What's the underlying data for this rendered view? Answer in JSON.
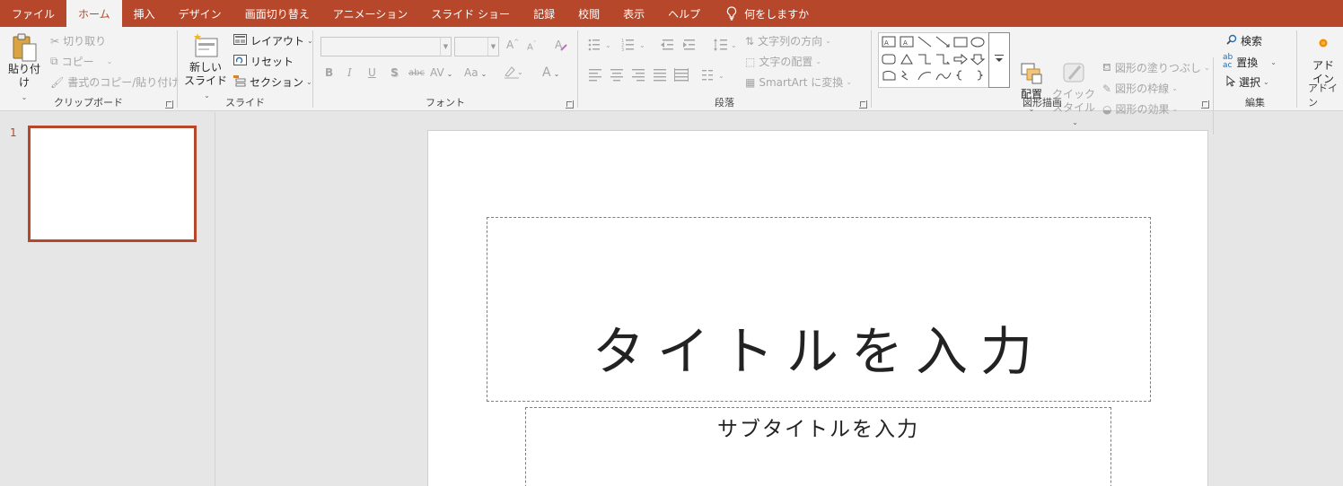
{
  "tabs": [
    {
      "label": "ファイル",
      "active": false
    },
    {
      "label": "ホーム",
      "active": true
    },
    {
      "label": "挿入",
      "active": false
    },
    {
      "label": "デザイン",
      "active": false
    },
    {
      "label": "画面切り替え",
      "active": false
    },
    {
      "label": "アニメーション",
      "active": false
    },
    {
      "label": "スライド ショー",
      "active": false
    },
    {
      "label": "記録",
      "active": false
    },
    {
      "label": "校閲",
      "active": false
    },
    {
      "label": "表示",
      "active": false
    },
    {
      "label": "ヘルプ",
      "active": false
    }
  ],
  "tell_me": "何をしますか",
  "colors": {
    "accent": "#b7472a",
    "ribbon_bg": "#f3f3f3",
    "canvas_bg": "#e6e6e6"
  },
  "clipboard": {
    "paste": "貼り付け",
    "cut": "切り取り",
    "copy": "コピー",
    "format_painter": "書式のコピー/貼り付け",
    "group_label": "クリップボード"
  },
  "slides": {
    "new_slide_line1": "新しい",
    "new_slide_line2": "スライド",
    "layout": "レイアウト",
    "reset": "リセット",
    "section": "セクション",
    "group_label": "スライド"
  },
  "font": {
    "font_name": "",
    "font_size": "",
    "bold": "B",
    "italic": "I",
    "underline": "U",
    "shadow": "S",
    "strike": "abc",
    "spacing": "AV",
    "change_case": "Aa",
    "font_color": "A",
    "group_label": "フォント"
  },
  "paragraph": {
    "text_direction": "文字列の方向",
    "align_text": "文字の配置",
    "smartart": "SmartArt に変換",
    "group_label": "段落"
  },
  "drawing": {
    "arrange": "配置",
    "quick_styles_line1": "クイック",
    "quick_styles_line2": "スタイル",
    "shape_fill": "図形の塗りつぶし",
    "shape_outline": "図形の枠線",
    "shape_effects": "図形の効果",
    "group_label": "図形描画"
  },
  "editing": {
    "find": "検索",
    "replace": "置換",
    "select": "選択",
    "group_label": "編集"
  },
  "addins": {
    "label_line1": "アド",
    "label_line2": "イン",
    "group_label": "アドイン"
  },
  "thumbnails": [
    {
      "number": "1"
    }
  ],
  "slide_content": {
    "title_placeholder": "タイトルを入力",
    "subtitle_placeholder": "サブタイトルを入力"
  }
}
